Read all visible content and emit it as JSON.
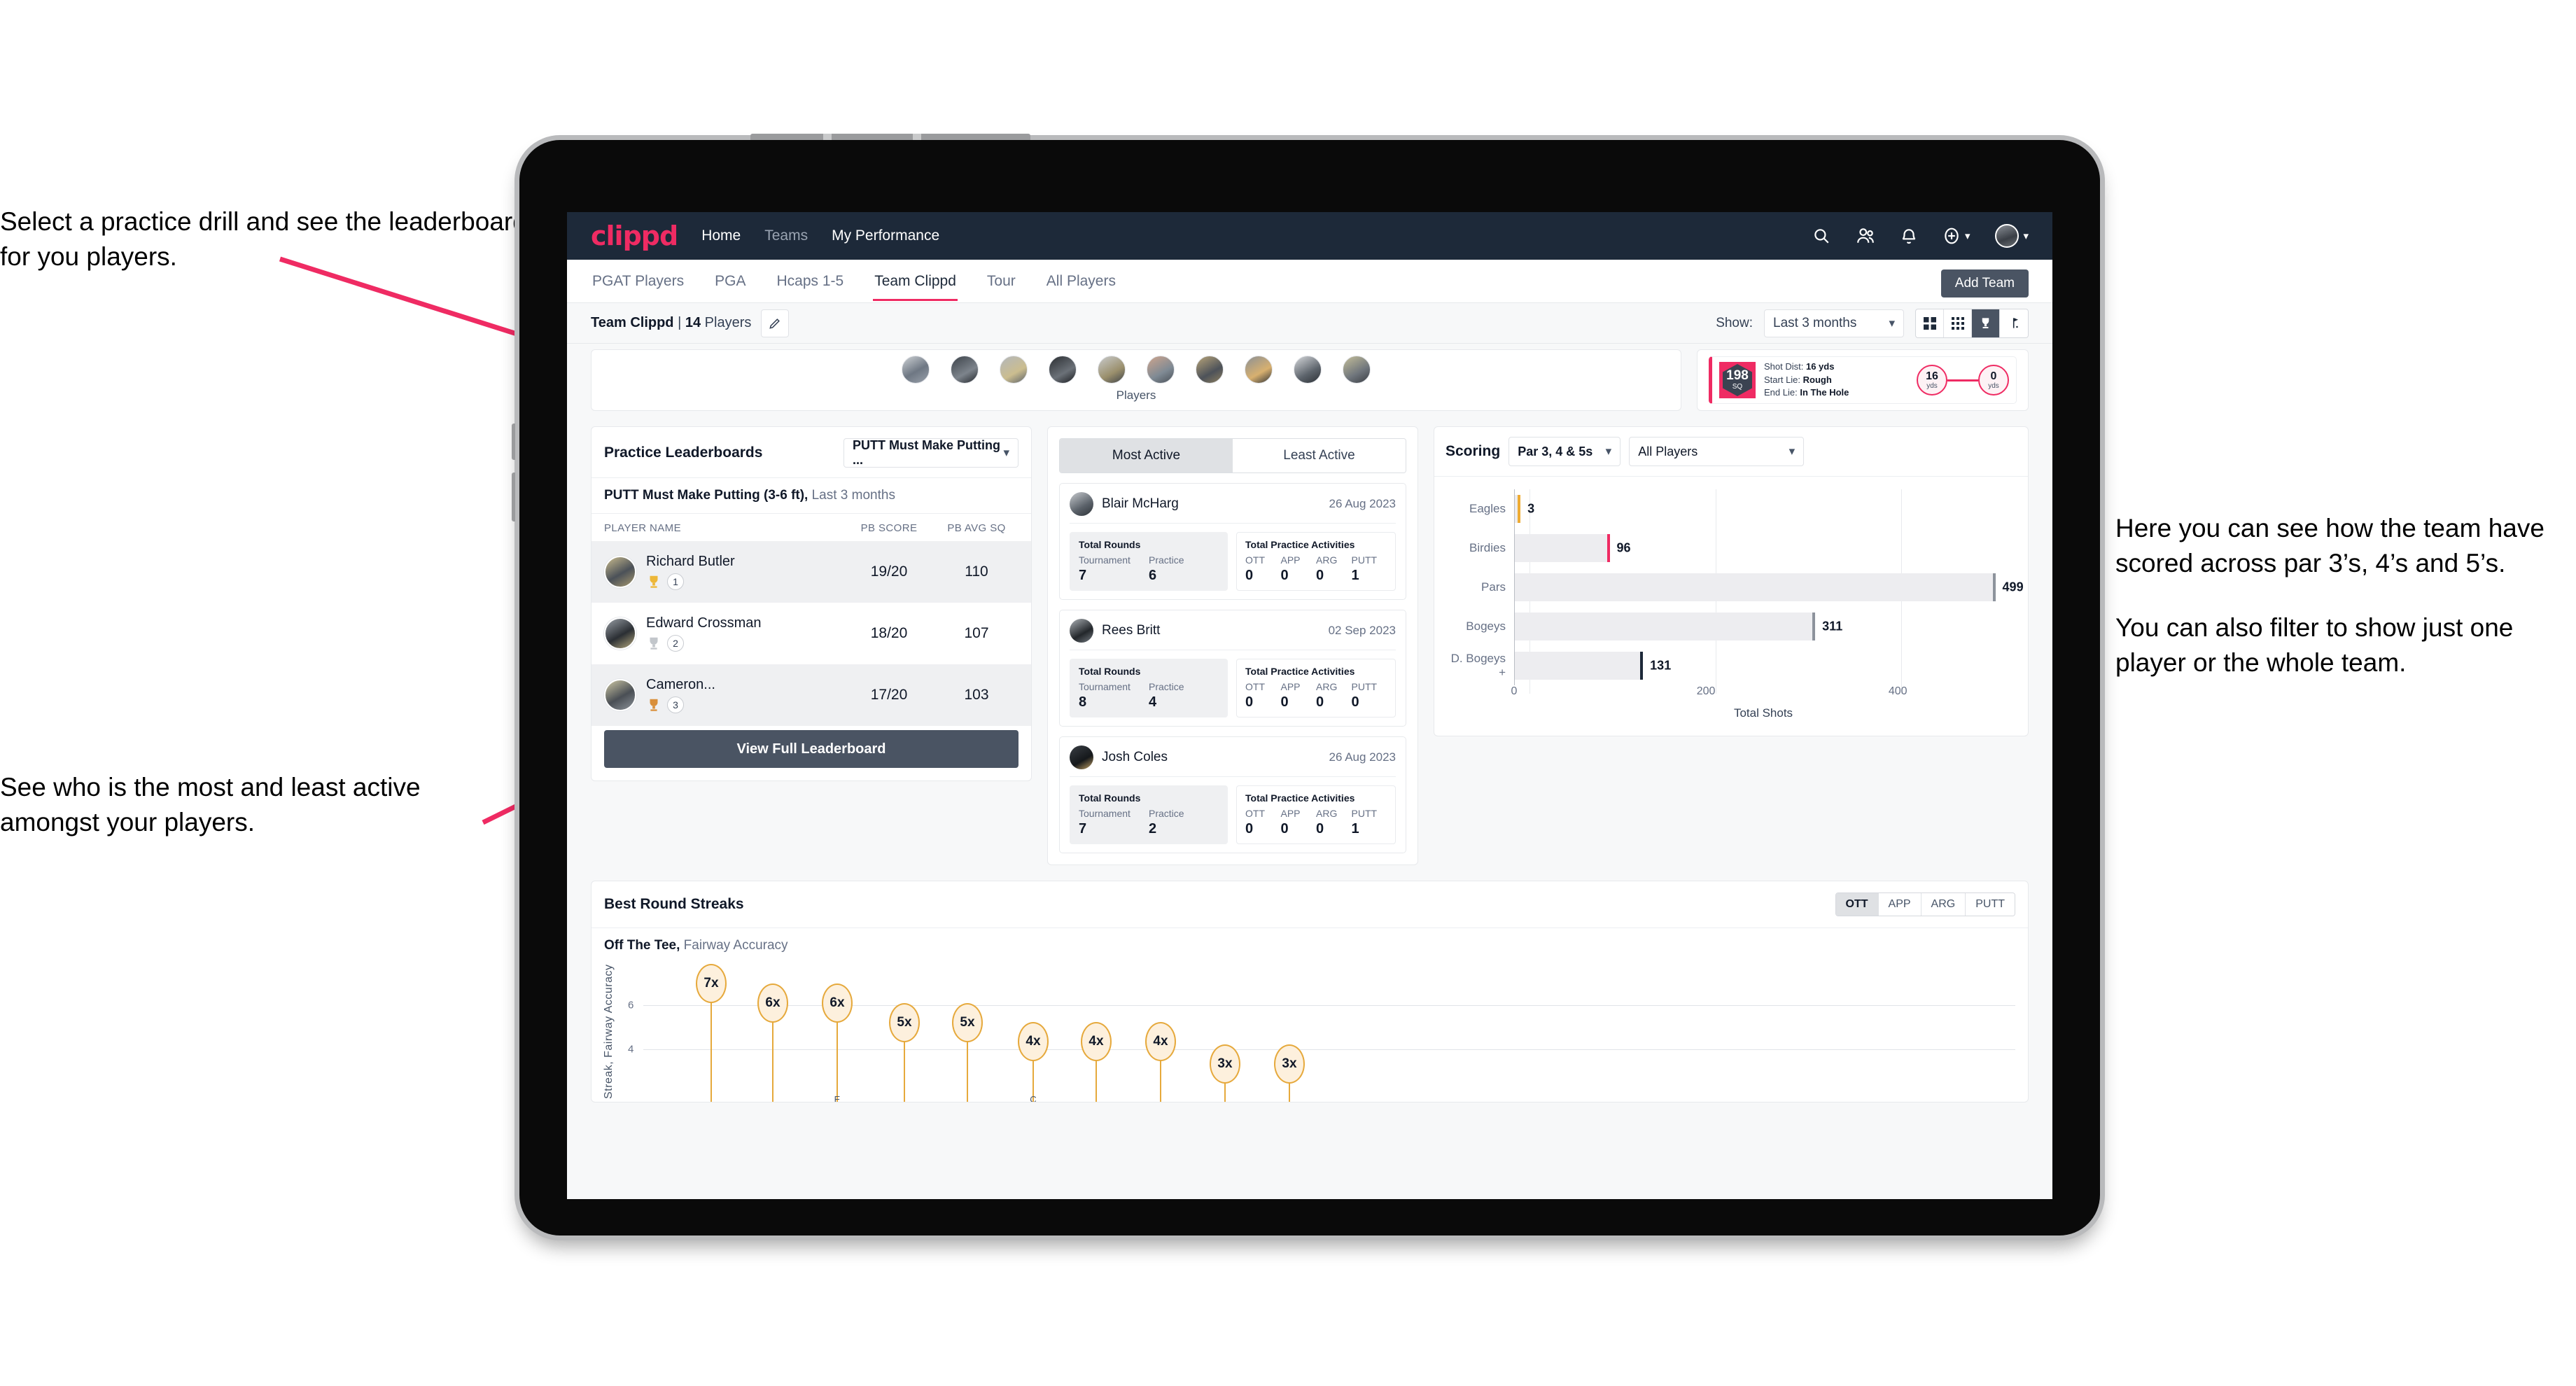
{
  "annotations": {
    "top_left": "Select a practice drill and see the leaderboard for you players.",
    "bottom_left": "See who is the most and least active amongst your players.",
    "right_1": "Here you can see how the team have scored across par 3’s, 4’s and 5’s.",
    "right_2": "You can also filter to show just one player or the whole team.",
    "arrow_color": "#ef2b63"
  },
  "app": {
    "logo": "clippd",
    "nav": [
      {
        "label": "Home",
        "active": true
      },
      {
        "label": "Teams",
        "active": false
      },
      {
        "label": "My Performance",
        "active": true
      }
    ],
    "icons": {
      "search": "search-icon",
      "people": "people-icon",
      "bell": "bell-icon",
      "plus": "plus-circle-icon",
      "avatar": "user-avatar"
    }
  },
  "tabs": {
    "items": [
      {
        "label": "PGAT Players",
        "active": false
      },
      {
        "label": "PGA",
        "active": false
      },
      {
        "label": "Hcaps 1-5",
        "active": false
      },
      {
        "label": "Team Clippd",
        "active": true
      },
      {
        "label": "Tour",
        "active": false
      },
      {
        "label": "All Players",
        "active": false
      }
    ],
    "add_team_label": "Add Team"
  },
  "toolbar": {
    "team_name": "Team Clippd",
    "separator": "|",
    "player_count": "14",
    "players_word": "Players",
    "edit_icon": "pencil-icon",
    "show_label": "Show:",
    "range_value": "Last 3 months",
    "view_modes": [
      {
        "name": "grid-large-icon",
        "active": false
      },
      {
        "name": "grid-small-icon",
        "active": false
      },
      {
        "name": "trophy-icon",
        "active": true
      },
      {
        "name": "flag-icon",
        "active": false
      }
    ]
  },
  "players_strip": {
    "label": "Players",
    "avatar_count": 10
  },
  "shot_card": {
    "sq_value": "198",
    "sq_unit": "SQ",
    "lines": [
      {
        "key": "Shot Dist:",
        "value": "16 yds"
      },
      {
        "key": "Start Lie:",
        "value": "Rough"
      },
      {
        "key": "End Lie:",
        "value": "In The Hole"
      }
    ],
    "start_dist": {
      "value": "16",
      "unit": "yds"
    },
    "end_dist": {
      "value": "0",
      "unit": "yds"
    }
  },
  "leaderboard": {
    "title": "Practice Leaderboards",
    "drill_select": "PUTT Must Make Putting ...",
    "subtitle_bold": "PUTT Must Make Putting (3-6 ft),",
    "subtitle_muted": "Last 3 months",
    "columns": [
      "PLAYER NAME",
      "PB SCORE",
      "PB AVG SQ"
    ],
    "rows": [
      {
        "name": "Richard Butler",
        "rank": "1",
        "medal": "gold",
        "pb_score": "19/20",
        "pb_avg_sq": "110"
      },
      {
        "name": "Edward Crossman",
        "rank": "2",
        "medal": "silver",
        "pb_score": "18/20",
        "pb_avg_sq": "107"
      },
      {
        "name": "Cameron...",
        "rank": "3",
        "medal": "bronze",
        "pb_score": "17/20",
        "pb_avg_sq": "103"
      }
    ],
    "button_label": "View Full Leaderboard"
  },
  "activity": {
    "tabs": [
      {
        "label": "Most Active",
        "active": true
      },
      {
        "label": "Least Active",
        "active": false
      }
    ],
    "rounds_title": "Total Rounds",
    "practice_title": "Total Practice Activities",
    "rounds_keys": [
      "Tournament",
      "Practice"
    ],
    "practice_keys": [
      "OTT",
      "APP",
      "ARG",
      "PUTT"
    ],
    "players": [
      {
        "name": "Blair McHarg",
        "date": "26 Aug 2023",
        "rounds": [
          "7",
          "6"
        ],
        "practice": [
          "0",
          "0",
          "0",
          "1"
        ]
      },
      {
        "name": "Rees Britt",
        "date": "02 Sep 2023",
        "rounds": [
          "8",
          "4"
        ],
        "practice": [
          "0",
          "0",
          "0",
          "0"
        ]
      },
      {
        "name": "Josh Coles",
        "date": "26 Aug 2023",
        "rounds": [
          "7",
          "2"
        ],
        "practice": [
          "0",
          "0",
          "0",
          "1"
        ]
      }
    ]
  },
  "scoring": {
    "title": "Scoring",
    "par_filter": "Par 3, 4 & 5s",
    "player_filter": "All Players"
  },
  "streaks": {
    "title": "Best Round Streaks",
    "toggle": [
      {
        "label": "OTT",
        "active": true
      },
      {
        "label": "APP",
        "active": false
      },
      {
        "label": "ARG",
        "active": false
      },
      {
        "label": "PUTT",
        "active": false
      }
    ],
    "subtitle_bold": "Off The Tee,",
    "subtitle_muted": "Fairway Accuracy"
  },
  "chart_data": [
    {
      "type": "bar",
      "orientation": "horizontal",
      "title": "Scoring",
      "categories": [
        "Eagles",
        "Birdies",
        "Pars",
        "Bogeys",
        "D. Bogeys +"
      ],
      "values": [
        3,
        96,
        499,
        311,
        131
      ],
      "cap_colors": [
        "#eeab33",
        "#ef2b63",
        "#8d939c",
        "#8d939c",
        "#1d2939"
      ],
      "bar_color": "#ededf0",
      "xlabel": "Total Shots",
      "ylabel": "",
      "xlim": [
        0,
        520
      ],
      "xticks": [
        0,
        200,
        400
      ],
      "grid": true,
      "legend": "none"
    },
    {
      "type": "scatter",
      "title": "Best Round Streaks",
      "subtitle": "Off The Tee, Fairway Accuracy",
      "ylabel": "Streak, Fairway Accuracy",
      "values": [
        7,
        6,
        6,
        5,
        5,
        4,
        4,
        4,
        3,
        3
      ],
      "labels": [
        "7x",
        "6x",
        "6x",
        "5x",
        "5x",
        "4x",
        "4x",
        "4x",
        "3x",
        "3x"
      ],
      "yticks": [
        4,
        6
      ],
      "ylim": [
        0,
        8
      ],
      "marker": "lollipop-bubble",
      "marker_color": "#fdf0dd",
      "marker_border": "#e6a93c"
    }
  ]
}
